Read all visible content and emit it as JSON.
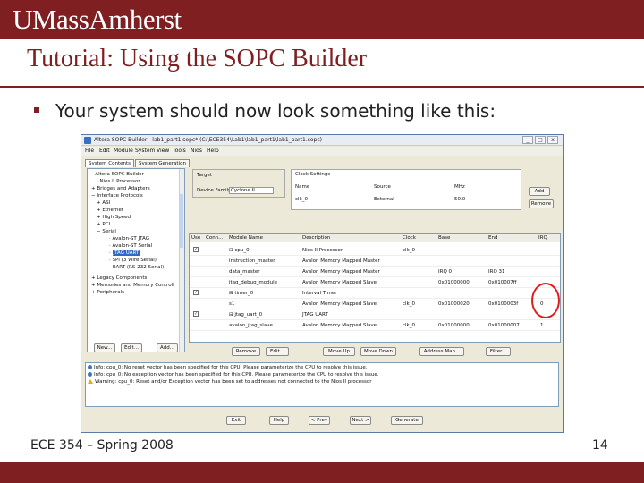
{
  "slide": {
    "brand": "UMassAmherst",
    "title": "Tutorial:  Using the SOPC Builder",
    "bullet": "Your system should now look something like this:",
    "footer_left": "ECE 354 – Spring 2008",
    "page_number": "14"
  },
  "colors": {
    "brand_maroon": "#7f1f22",
    "highlight_red": "#e21b1b",
    "selection_blue": "#316ac5"
  },
  "window": {
    "title": "Altera SOPC Builder - lab1_part1.sopc* (C:\\ECE354\\Lab1\\lab1_part1\\lab1_part1.sopc)",
    "controls": [
      "_",
      "□",
      "x"
    ],
    "menu": [
      "File",
      "Edit",
      "Module",
      "System",
      "View",
      "Tools",
      "Nios",
      "Help"
    ],
    "tabs": [
      "System Contents",
      "System Generation"
    ],
    "tree": [
      {
        "label": "Altera SOPC Builder",
        "mark": "−"
      },
      {
        "label": "Nios II Processor",
        "mark": "·"
      },
      {
        "label": "Bridges and Adapters",
        "mark": "+"
      },
      {
        "label": "Interface Protocols",
        "mark": "−"
      },
      {
        "label": "ASI",
        "mark": "+"
      },
      {
        "label": "Ethernet",
        "mark": "+"
      },
      {
        "label": "High Speed",
        "mark": "+"
      },
      {
        "label": "PCI",
        "mark": "+"
      },
      {
        "label": "Serial",
        "mark": "−"
      },
      {
        "label": "Avalon-ST JTAG",
        "mark": "·"
      },
      {
        "label": "Avalon-ST Serial",
        "mark": "·"
      },
      {
        "label": "JTAG UART",
        "mark": "·",
        "selected": true
      },
      {
        "label": "SPI (3 Wire Serial)",
        "mark": "·"
      },
      {
        "label": "UART (RS-232 Serial)",
        "mark": "·"
      },
      {
        "label": "Legacy Components",
        "mark": "+"
      },
      {
        "label": "Memories and Memory Controll",
        "mark": "+"
      },
      {
        "label": "Peripherals",
        "mark": "+"
      }
    ],
    "left_buttons": [
      "New...",
      "Edit...",
      "Add..."
    ],
    "target": {
      "header": "Target",
      "device_family_label": "Device Family:",
      "device_family_value": "Cyclone II"
    },
    "clock": {
      "header": "Clock Settings",
      "columns": [
        "Name",
        "Source",
        "MHz"
      ],
      "row": [
        "clk_0",
        "External",
        "50.0"
      ],
      "add": "Add",
      "remove": "Remove"
    },
    "grid": {
      "columns": [
        "Use",
        "Conn...",
        "Module Name",
        "Description",
        "Clock",
        "Base",
        "End",
        "IRQ"
      ],
      "rows": [
        {
          "use": "✓",
          "conn": "",
          "module": "⊟ cpu_0",
          "desc": "Nios II Processor",
          "clock": "clk_0",
          "base": "",
          "end": "",
          "irq": ""
        },
        {
          "use": "",
          "conn": "",
          "module": "instruction_master",
          "desc": "Avalon Memory Mapped Master",
          "clock": "",
          "base": "",
          "end": "",
          "irq": ""
        },
        {
          "use": "",
          "conn": "",
          "module": "data_master",
          "desc": "Avalon Memory Mapped Master",
          "clock": "",
          "base": "IRQ 0",
          "end": "IRQ 31",
          "irq": ""
        },
        {
          "use": "",
          "conn": "",
          "module": "jtag_debug_module",
          "desc": "Avalon Memory Mapped Slave",
          "clock": "",
          "base": "0x01000000",
          "end": "0x010007ff",
          "irq": ""
        },
        {
          "use": "✓",
          "conn": "",
          "module": "⊟ timer_0",
          "desc": "Interval Timer",
          "clock": "",
          "base": "",
          "end": "",
          "irq": ""
        },
        {
          "use": "",
          "conn": "",
          "module": "s1",
          "desc": "Avalon Memory Mapped Slave",
          "clock": "clk_0",
          "base": "0x01000020",
          "end": "0x0100003f",
          "irq": "0"
        },
        {
          "use": "✓",
          "conn": "",
          "module": "⊟ jtag_uart_0",
          "desc": "JTAG UART",
          "clock": "",
          "base": "",
          "end": "",
          "irq": ""
        },
        {
          "use": "",
          "conn": "",
          "module": "avalon_jtag_slave",
          "desc": "Avalon Memory Mapped Slave",
          "clock": "clk_0",
          "base": "0x01000000",
          "end": "0x01000007",
          "irq": "1"
        }
      ]
    },
    "grid_buttons": [
      "Remove",
      "Edit...",
      "Move Up",
      "Move Down",
      "Address Map...",
      "Filter..."
    ],
    "messages": [
      {
        "type": "info",
        "text": "Info: cpu_0: No reset vector has been specified for this CPU. Please parameterize the CPU to resolve this issue."
      },
      {
        "type": "info",
        "text": "Info: cpu_0: No exception vector has been specified for this CPU. Please parameterize the CPU to resolve this issue."
      },
      {
        "type": "warning",
        "text": "Warning: cpu_0: Reset and/or Exception vector has been set to addresses not connected to the Nios II processor"
      }
    ],
    "bottom_buttons": [
      "Exit",
      "Help",
      "< Prev",
      "Next >",
      "Generate"
    ]
  }
}
